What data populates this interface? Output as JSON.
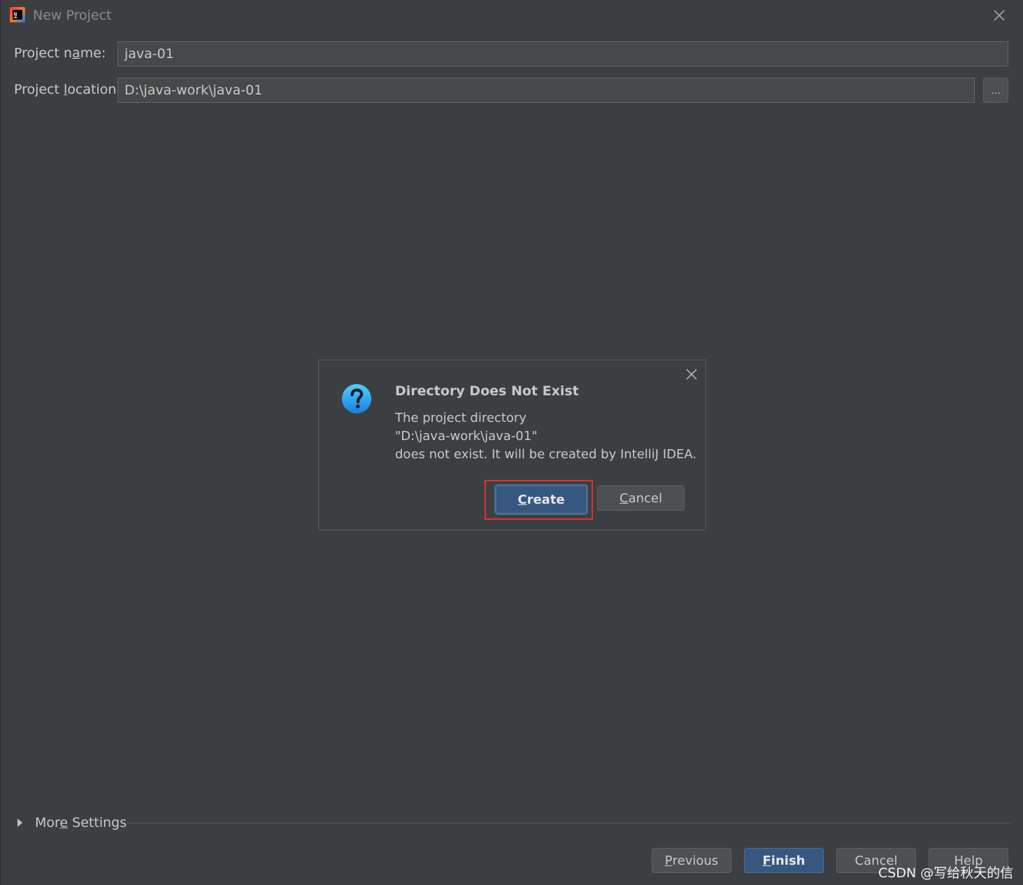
{
  "window": {
    "title": "New Project",
    "app_icon": "intellij-idea-icon",
    "close_icon": "close-icon"
  },
  "form": {
    "project_name_label_pre": "Project n",
    "project_name_label_mnemonic": "a",
    "project_name_label_post": "me:",
    "project_name_value": "java-01",
    "project_location_label_pre": "Project ",
    "project_location_label_mnemonic": "l",
    "project_location_label_post": "ocation:",
    "project_location_value": "D:\\java-work\\java-01",
    "browse_label": "..."
  },
  "dialog": {
    "title": "Directory Does Not Exist",
    "icon": "question-icon",
    "message_line1": "The project directory",
    "message_line2": "\"D:\\java-work\\java-01\"",
    "message_line3": "does not exist. It will be created by IntelliJ IDEA.",
    "create_mnemonic": "C",
    "create_rest": "reate",
    "cancel_mnemonic": "C",
    "cancel_rest": "ancel",
    "highlight_color": "#e0302e"
  },
  "footer": {
    "more_settings_pre": "Mor",
    "more_settings_mnemonic": "e",
    "more_settings_post": " Settings",
    "previous_mnemonic": "P",
    "previous_rest": "revious",
    "finish_mnemonic": "F",
    "finish_rest": "inish",
    "cancel_label": "Cancel",
    "help_label": "Help"
  },
  "watermark": "CSDN @写给秋天的信",
  "colors": {
    "background": "#3c3f41",
    "field_background": "#45494a",
    "default_button": "#365880",
    "text": "#c8c8c8"
  }
}
